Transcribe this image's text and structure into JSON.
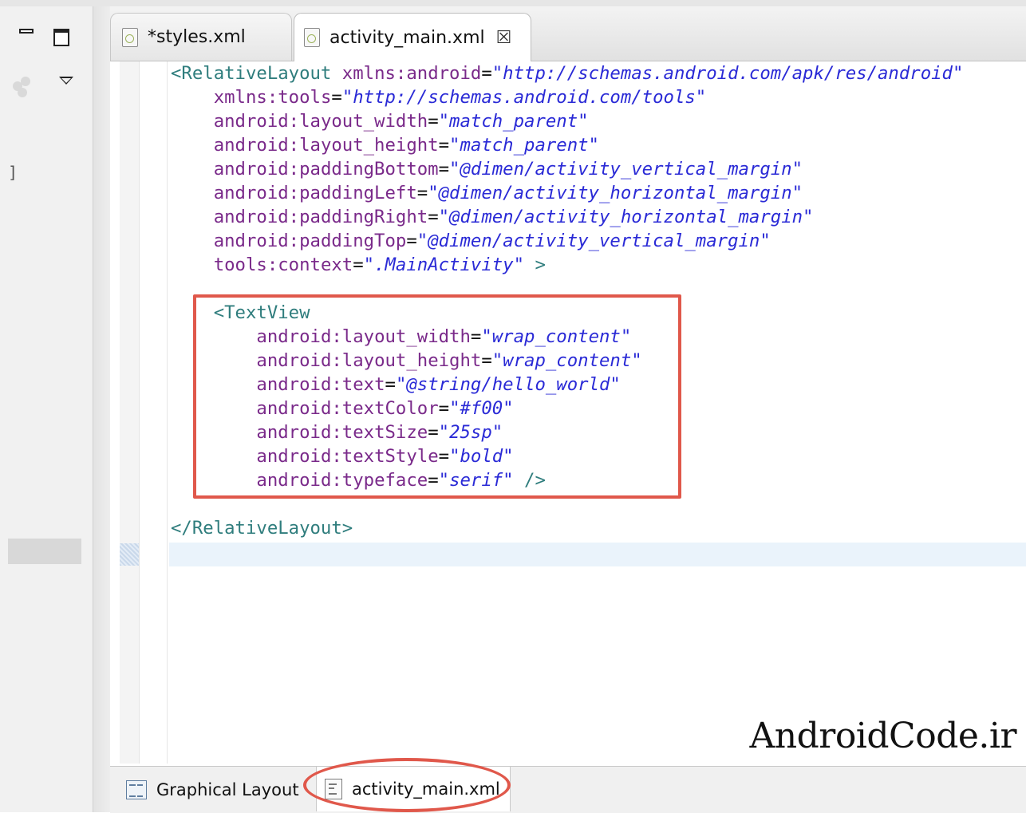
{
  "window": {
    "tabs": [
      {
        "label": "*styles.xml",
        "active": false
      },
      {
        "label": "activity_main.xml",
        "active": true
      }
    ]
  },
  "editor": {
    "root_open_tag": "<RelativeLayout",
    "root_attrs": [
      {
        "name": "xmlns:android",
        "value": "\"http://schemas.android.com/apk/res/android\""
      },
      {
        "name": "xmlns:tools",
        "value": "\"http://schemas.android.com/tools\""
      },
      {
        "name": "android:layout_width",
        "value": "\"match_parent\""
      },
      {
        "name": "android:layout_height",
        "value": "\"match_parent\""
      },
      {
        "name": "android:paddingBottom",
        "value": "\"@dimen/activity_vertical_margin\""
      },
      {
        "name": "android:paddingLeft",
        "value": "\"@dimen/activity_horizontal_margin\""
      },
      {
        "name": "android:paddingRight",
        "value": "\"@dimen/activity_horizontal_margin\""
      },
      {
        "name": "android:paddingTop",
        "value": "\"@dimen/activity_vertical_margin\""
      },
      {
        "name": "tools:context",
        "value": "\".MainActivity\""
      }
    ],
    "root_close_bracket": " >",
    "textview_open_tag": "<TextView",
    "textview_attrs": [
      {
        "name": "android:layout_width",
        "value": "\"wrap_content\""
      },
      {
        "name": "android:layout_height",
        "value": "\"wrap_content\""
      },
      {
        "name": "android:text",
        "value": "\"@string/hello_world\""
      },
      {
        "name": "android:textColor",
        "value": "\"#f00\""
      },
      {
        "name": "android:textSize",
        "value": "\"25sp\""
      },
      {
        "name": "android:textStyle",
        "value": "\"bold\""
      },
      {
        "name": "android:typeface",
        "value": "\"serif\""
      }
    ],
    "textview_self_close": " />",
    "root_close_tag": "</RelativeLayout>",
    "watermark": "AndroidCode.ir"
  },
  "bottom_tabs": [
    {
      "label": "Graphical Layout",
      "active": false
    },
    {
      "label": "activity_main.xml",
      "active": true
    }
  ],
  "colors": {
    "tag": "#2f7d7d",
    "attribute": "#7a2a8a",
    "value": "#2a2ad6",
    "annotation": "#e0584b"
  }
}
